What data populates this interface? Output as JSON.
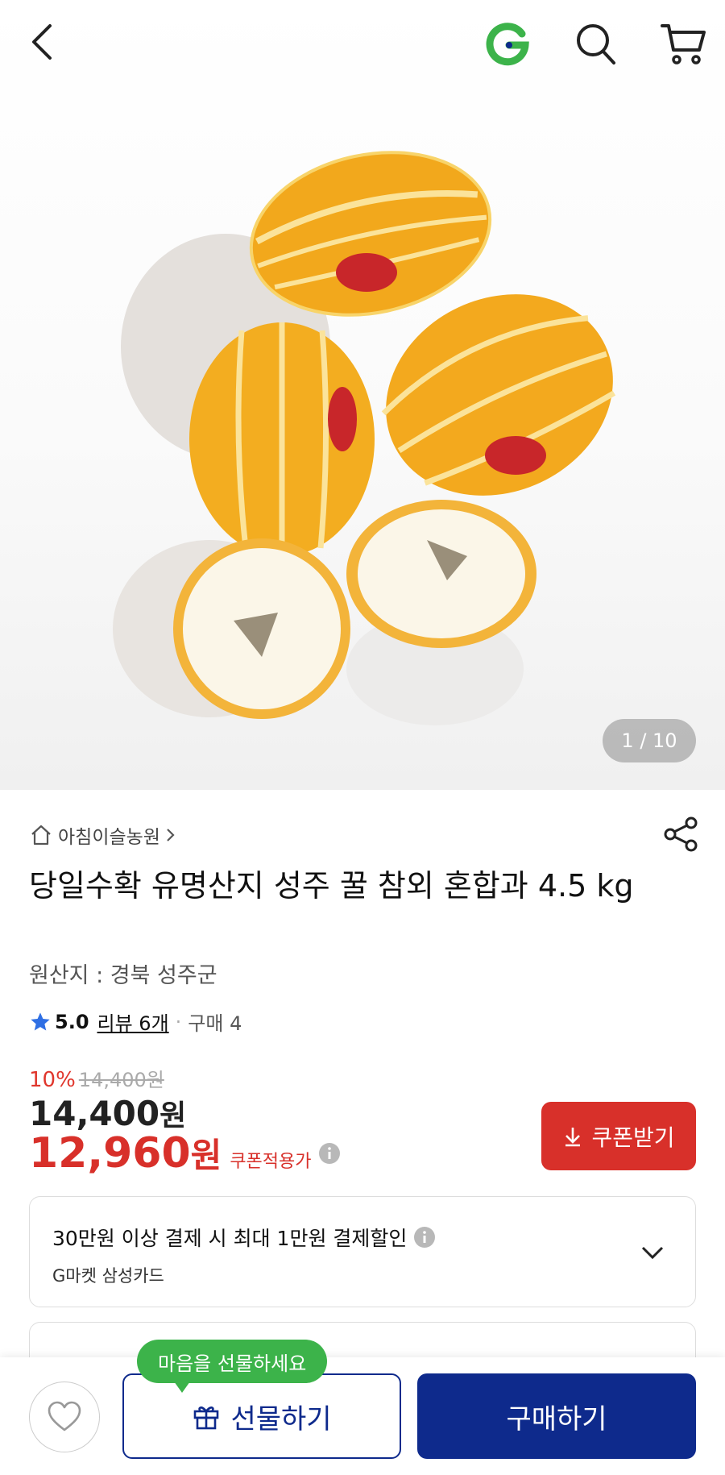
{
  "header": {
    "back_icon": "chevron-left-icon",
    "logo_icon": "gmarket-g-logo",
    "search_icon": "search-icon",
    "cart_icon": "cart-icon"
  },
  "gallery": {
    "pager_text": "1 / 10",
    "current": 1,
    "total": 10
  },
  "product": {
    "seller": "아침이슬농원",
    "title": "당일수확 유명산지 성주 꿀 참외 혼합과 4.5 kg",
    "origin": "원산지 : 경북 성주군",
    "rating": "5.0",
    "reviews": "리뷰 6개",
    "separator": "·",
    "purchases": "구매 4"
  },
  "price": {
    "discount_pct": "10%",
    "original": "14,400원",
    "list_amount": "14,400",
    "list_unit": "원",
    "sale_amount": "12,960",
    "sale_unit": "원",
    "coupon_note": "쿠폰적용가",
    "coupon_button": "쿠폰받기"
  },
  "card_promo": {
    "line1": "30만원 이상 결제 시 최대 1만원 결제할인",
    "line2": "G마켓 삼성카드"
  },
  "bottom_bar": {
    "tooltip": "마음을 선물하세요",
    "gift_button": "선물하기",
    "buy_button": "구매하기"
  },
  "colors": {
    "sale_red": "#d8302a",
    "primary_blue": "#0e2a8c",
    "tooltip_green": "#3cb34a",
    "logo_green": "#3cb34a"
  }
}
